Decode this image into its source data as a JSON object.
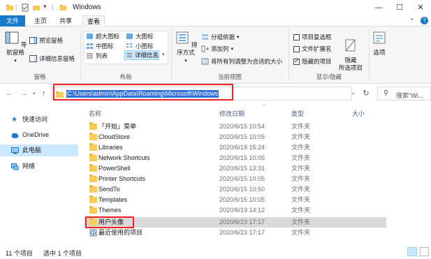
{
  "window": {
    "title": "Windows",
    "minimize": "—",
    "maximize": "☐",
    "close": "✕"
  },
  "tabs": [
    {
      "label": "文件"
    },
    {
      "label": "主页"
    },
    {
      "label": "共享"
    },
    {
      "label": "查看"
    }
  ],
  "ribbon": {
    "pane_group": {
      "label": "窗格",
      "nav_pane": "导航窗格",
      "preview_pane": "预览窗格",
      "details_pane": "详细信息窗格"
    },
    "layout_group": {
      "label": "布局",
      "options": [
        "超大图标",
        "大图标",
        "中图标",
        "小图标",
        "列表",
        "详细信息"
      ],
      "selected": "详细信息"
    },
    "current_view_group": {
      "label": "当前视图",
      "sort_by": "排序方式",
      "group_by": "分组依据",
      "add_columns": "添加列",
      "size_columns": "将所有列调整为合适的大小"
    },
    "show_hide_group": {
      "label": "显示/隐藏",
      "item_checkboxes": {
        "label": "项目复选框",
        "checked": false
      },
      "file_extensions": {
        "label": "文件扩展名",
        "checked": false
      },
      "hidden_items": {
        "label": "隐藏的项目",
        "checked": true
      },
      "hide_selected": "隐藏\n所选项目"
    },
    "options": "选项"
  },
  "address_bar": {
    "path": "C:\\Users\\admin\\AppData\\Roaming\\Microsoft\\Windows",
    "search_placeholder": "搜索\"Wi..."
  },
  "sidebar": {
    "items": [
      {
        "label": "快速访问",
        "icon": "star-icon"
      },
      {
        "label": "OneDrive",
        "icon": "cloud-icon"
      },
      {
        "label": "此电脑",
        "icon": "computer-icon"
      },
      {
        "label": "网络",
        "icon": "network-icon"
      }
    ],
    "selected": "此电脑"
  },
  "file_list": {
    "columns": [
      "名称",
      "修改日期",
      "类型",
      "大小"
    ],
    "rows": [
      {
        "name": "「开始」菜单",
        "date": "2020/6/15 10:54",
        "type": "文件夹"
      },
      {
        "name": "CloudStore",
        "date": "2020/6/15 10:05",
        "type": "文件夹"
      },
      {
        "name": "Libraries",
        "date": "2020/6/18 15:24",
        "type": "文件夹"
      },
      {
        "name": "Network Shortcuts",
        "date": "2020/6/15 10:05",
        "type": "文件夹"
      },
      {
        "name": "PowerShell",
        "date": "2020/6/15 13:31",
        "type": "文件夹"
      },
      {
        "name": "Printer Shortcuts",
        "date": "2020/6/15 10:05",
        "type": "文件夹"
      },
      {
        "name": "SendTo",
        "date": "2020/6/15 10:50",
        "type": "文件夹"
      },
      {
        "name": "Templates",
        "date": "2020/6/15 10:05",
        "type": "文件夹"
      },
      {
        "name": "Themes",
        "date": "2020/6/19 14:12",
        "type": "文件夹"
      },
      {
        "name": "用户头像",
        "date": "2020/6/23 17:17",
        "type": "文件夹"
      },
      {
        "name": "最近使用的项目",
        "date": "2020/6/23 17:17",
        "type": "文件夹"
      }
    ],
    "selected_index": 9
  },
  "status_bar": {
    "item_count": "11 个项目",
    "selected_count": "选中 1 个项目"
  },
  "colors": {
    "accent": "#1979ca",
    "selection": "#cce8ff",
    "highlight_box": "#e22222",
    "folder": "#f7cc5b"
  }
}
